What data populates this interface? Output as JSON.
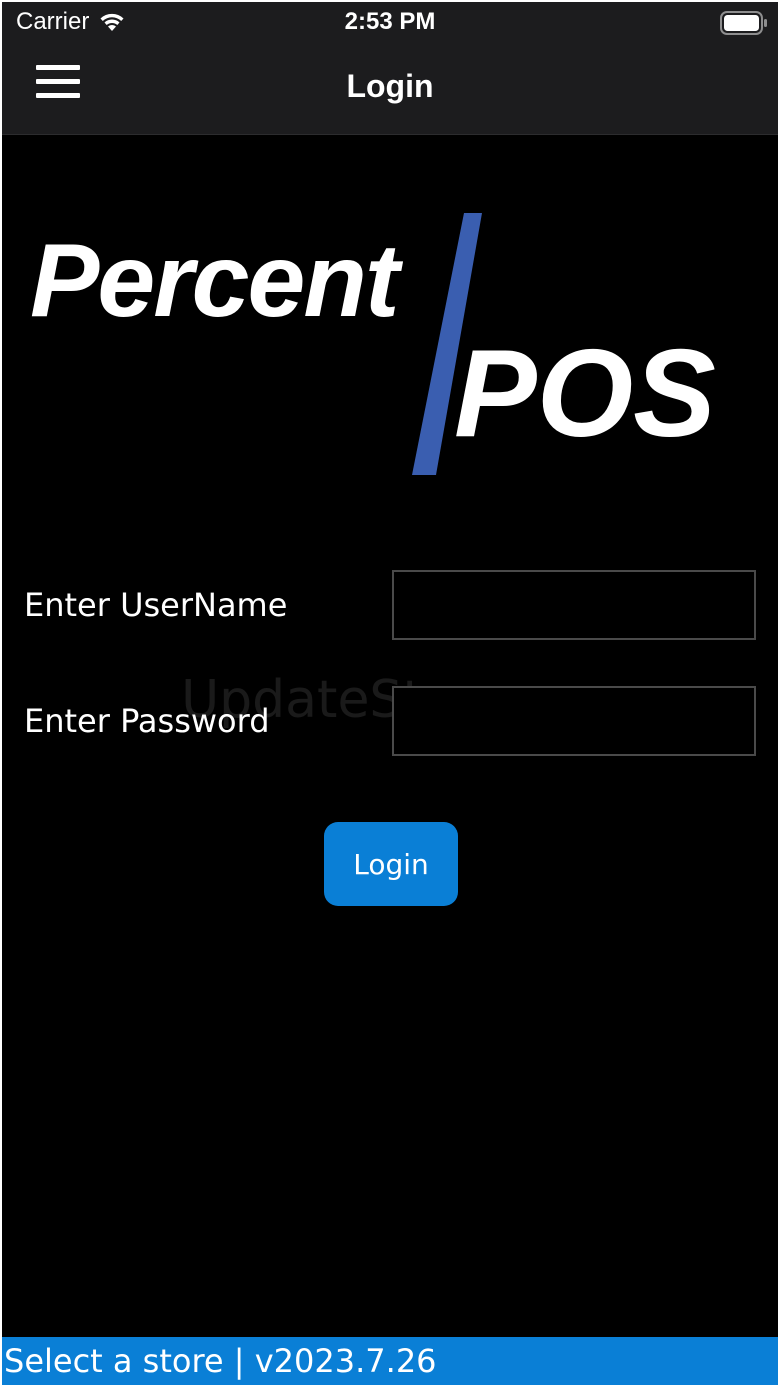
{
  "status_bar": {
    "carrier": "Carrier",
    "time": "2:53 PM",
    "icons": [
      "wifi-icon",
      "battery-icon"
    ]
  },
  "nav": {
    "title": "Login",
    "menu_icon": "hamburger-menu-icon"
  },
  "logo": {
    "line1": "Percent",
    "line2": "POS",
    "accent_color": "#3a5eb0"
  },
  "watermark": "UpdateStar.com",
  "form": {
    "username_label": "Enter UserName",
    "username_value": "",
    "password_label": "Enter Password",
    "password_value": "",
    "login_label": "Login"
  },
  "footer": {
    "text": "Select a store | v2023.7.26"
  },
  "colors": {
    "background": "#000000",
    "bar": "#1c1c1e",
    "accent": "#0a7fd6"
  }
}
